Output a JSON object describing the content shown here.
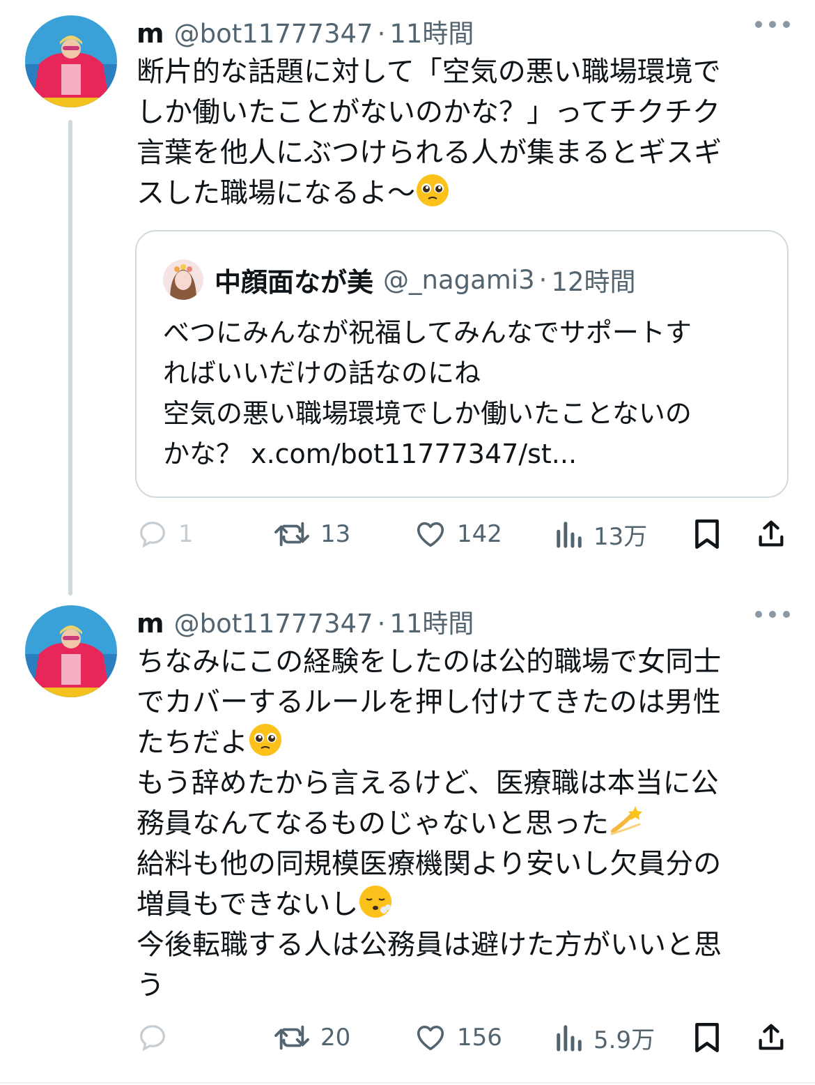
{
  "tweets": [
    {
      "name": "m",
      "handle": "@bot11777347",
      "separator": "·",
      "time": "11時間",
      "lines": [
        "断片的な話題に対して「空気の悪い職場環境で",
        "しか働いたことがないのかな？」ってチクチク",
        "言葉を他人にぶつけられる人が集まるとギスギ",
        "スした職場になるよ〜"
      ],
      "quote": {
        "name": "中顔面なが美",
        "handle": "@_nagami3",
        "separator": "·",
        "time": "12時間",
        "lines": [
          "べつにみんなが祝福してみんなでサポートす",
          "ればいいだけの話なのにね",
          "空気の悪い職場環境でしか働いたことないの",
          "かな？ x.com/bot11777347/st..."
        ]
      },
      "actions": {
        "replies": "1",
        "reposts": "13",
        "likes": "142",
        "views": "13万"
      }
    },
    {
      "name": "m",
      "handle": "@bot11777347",
      "separator": "·",
      "time": "11時間",
      "lines": [
        "ちなみにこの経験をしたのは公的職場で女同士",
        "でカバーするルールを押し付けてきたのは男性",
        "たちだよ",
        "もう辞めたから言えるけど、医療職は本当に公",
        "務員なんてなるものじゃないと思った",
        "給料も他の同規模医療機関より安いし欠員分の",
        "増員もできないし",
        "今後転職する人は公務員は避けた方がいいと思",
        "う"
      ],
      "actions": {
        "replies": "",
        "reposts": "20",
        "likes": "156",
        "views": "5.9万"
      }
    }
  ],
  "icons": [
    "more-icon",
    "reply-icon",
    "repost-icon",
    "like-icon",
    "views-icon",
    "bookmark-icon",
    "share-icon",
    "pleading-face-emoji",
    "dizzy-emoji",
    "exhale-face-emoji"
  ],
  "colors": {
    "text": "#0f1419",
    "secondary": "#536471",
    "border": "#cfd9de"
  }
}
